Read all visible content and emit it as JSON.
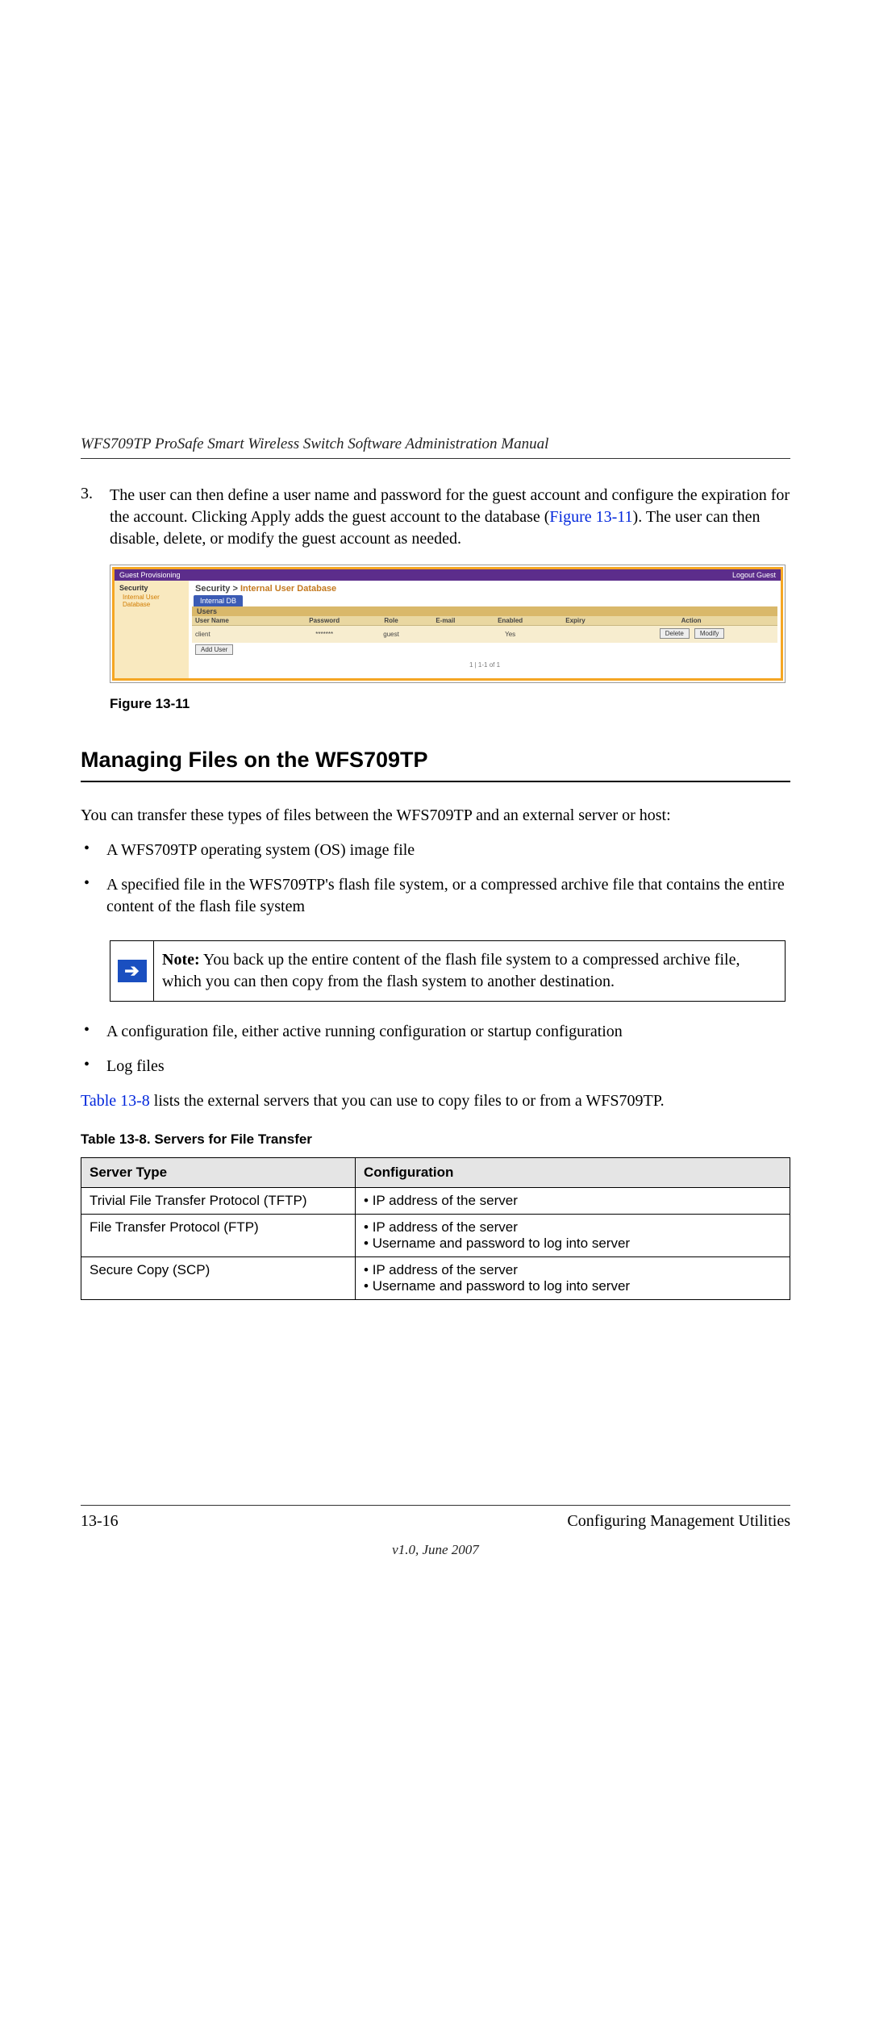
{
  "header_title": "WFS709TP ProSafe Smart Wireless Switch Software Administration Manual",
  "step": {
    "num": "3.",
    "text_1": "The user can then define a user name and password for the guest account and configure the expiration for the account. Clicking Apply adds the guest account to the database (",
    "link": "Figure 13-11",
    "text_2": "). The user can then disable, delete, or modify the guest account as needed."
  },
  "figure": {
    "bar_left": "Guest Provisioning",
    "bar_right": "Logout Guest",
    "side_head": "Security",
    "side_sub": "Internal User Database",
    "breadcrumb_a": "Security > ",
    "breadcrumb_b": "Internal User Database",
    "tab": "Internal DB",
    "users_label": "Users",
    "cols": [
      "User Name",
      "Password",
      "Role",
      "E-mail",
      "Enabled",
      "Expiry",
      "Action"
    ],
    "row": [
      "client",
      "*******",
      "guest",
      "",
      "Yes",
      ""
    ],
    "btn_delete": "Delete",
    "btn_modify": "Modify",
    "btn_add": "Add User",
    "pager": "1   | 1-1 of 1",
    "caption": "Figure 13-11"
  },
  "h2": "Managing Files on the WFS709TP",
  "intro": "You can transfer these types of files between the WFS709TP and an external server or host:",
  "bullets": [
    "A WFS709TP operating system (OS) image file",
    "A specified file in the WFS709TP's flash file system, or a compressed archive file that contains the entire content of the flash file system"
  ],
  "note": {
    "lead": "Note:",
    "text": " You back up the entire content of the flash file system to a compressed archive file, which you can then copy from the flash system to another destination."
  },
  "bullets2": [
    "A configuration file, either active running configuration or startup configuration",
    "Log files"
  ],
  "table_ref": {
    "link": "Table 13-8",
    "rest": " lists the external servers that you can use to copy files to or from a WFS709TP."
  },
  "table": {
    "caption": "Table 13-8.  Servers for File Transfer",
    "head": [
      "Server Type",
      "Configuration"
    ],
    "rows": [
      {
        "type": "Trivial File Transfer Protocol (TFTP)",
        "cfg": [
          "IP address of the server"
        ]
      },
      {
        "type": "File Transfer Protocol (FTP)",
        "cfg": [
          "IP address of the server",
          "Username and password to log into server"
        ]
      },
      {
        "type": "Secure Copy (SCP)",
        "cfg": [
          "IP address of the server",
          "Username and password to log into server"
        ]
      }
    ]
  },
  "footer": {
    "page": "13-16",
    "section": "Configuring Management Utilities",
    "version": "v1.0, June 2007"
  }
}
